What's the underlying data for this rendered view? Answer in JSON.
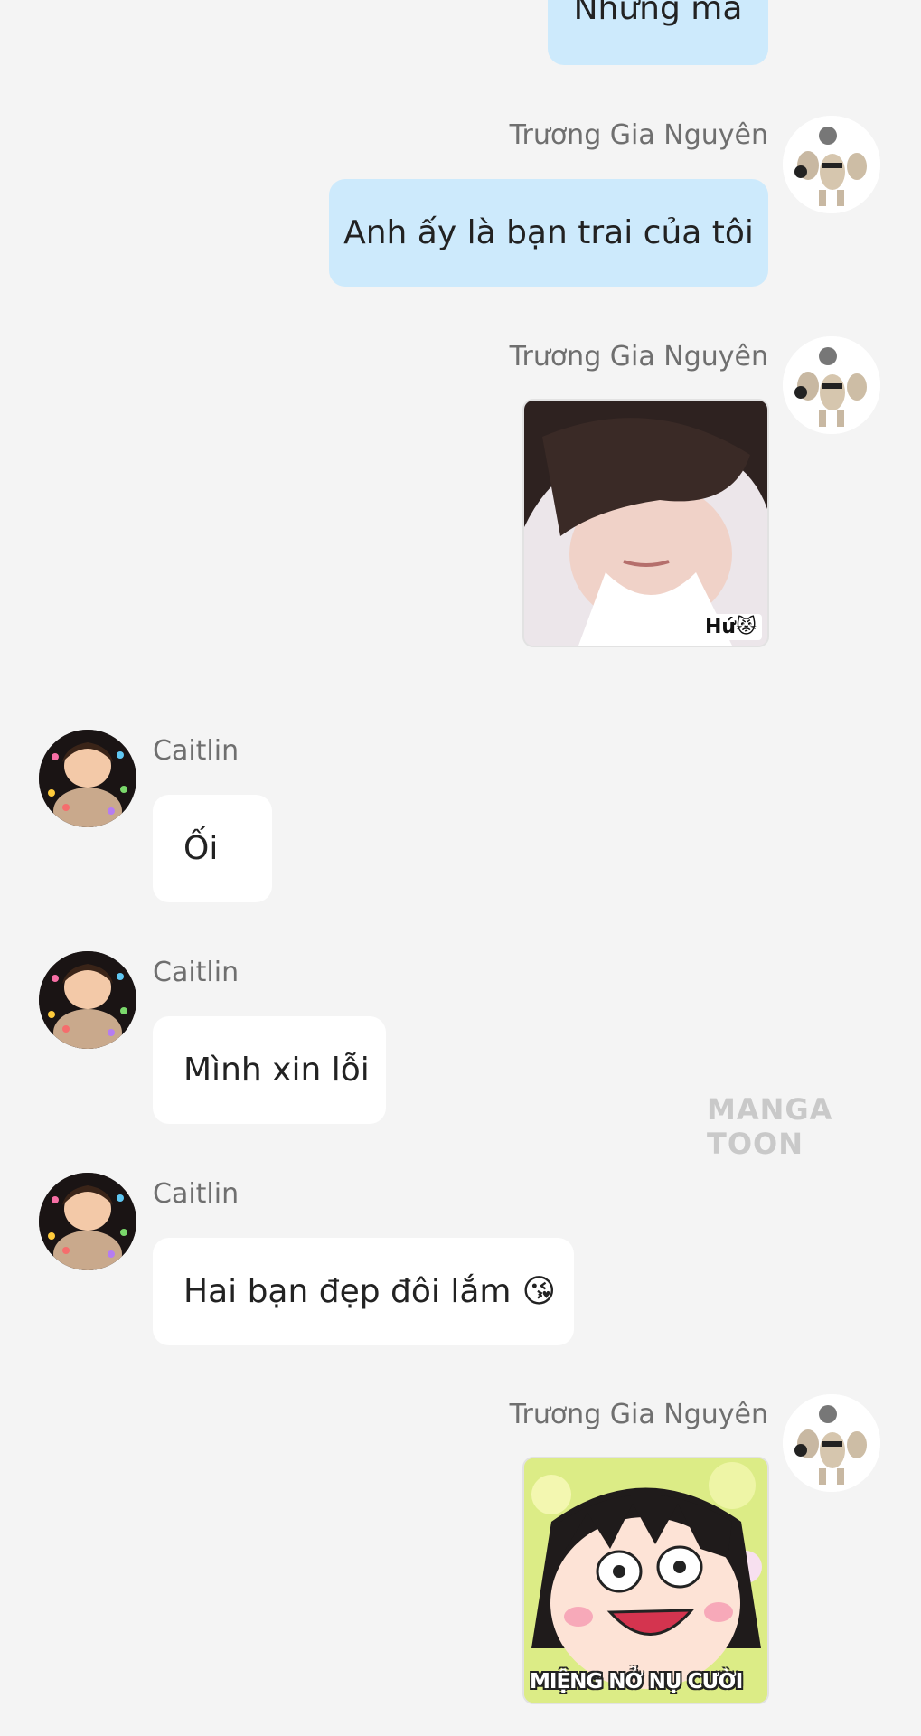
{
  "messages": [
    {
      "sender": "",
      "text": "Nhưng mà"
    },
    {
      "sender": "Trương Gia Nguyên",
      "text": "Anh ấy là bạn trai của tôi"
    },
    {
      "sender": "Trương Gia Nguyên",
      "sticker_caption": "Hứ"
    },
    {
      "sender": "Caitlin",
      "text": "Ối"
    },
    {
      "sender": "Caitlin",
      "text": "Mình xin lỗi"
    },
    {
      "sender": "Caitlin",
      "text": "Hai bạn đẹp đôi lắm",
      "emoji": "😘"
    },
    {
      "sender": "Trương Gia Nguyên",
      "sticker_caption": "MIỆNG NỞ NỤ CƯỜI"
    }
  ],
  "watermark": "MANGA TOON",
  "colors": {
    "background": "#f4f4f4",
    "my_bubble": "#cdeafc",
    "their_bubble": "#ffffff",
    "name_text": "#6f6f6f"
  }
}
